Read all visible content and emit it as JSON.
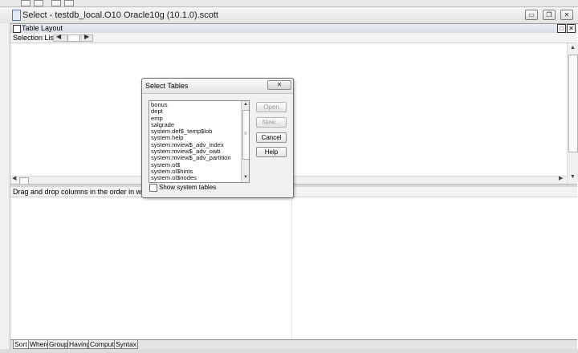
{
  "window": {
    "title": "Select - testdb_local.O10 Oracle10g (10.1.0).scott",
    "minimize_glyph": "▭",
    "restore_glyph": "❐",
    "close_glyph": "✕"
  },
  "table_layout": {
    "header": "Table Layout",
    "restore_glyph": "□",
    "close_glyph": "✕",
    "selection_list_label": "Selection List:"
  },
  "hint": {
    "text": "Drag and drop columns in the order in which you wa"
  },
  "tabs": [
    "Sort",
    "Where",
    "Group",
    "Having",
    "Compute",
    "Syntax"
  ],
  "dialog": {
    "title": "Select Tables",
    "close_glyph": "✕",
    "tables": [
      "bonus",
      "dept",
      "emp",
      "salgrade",
      "system.def$_temp$lob",
      "system.help",
      "system.mview$_adv_index",
      "system.mview$_adv_owb",
      "system.mview$_adv_partition",
      "system.ol$",
      "system.ol$hints",
      "system.ol$nodes"
    ],
    "buttons": {
      "open": "Open",
      "new": "New...",
      "cancel": "Cancel",
      "help": "Help"
    },
    "show_system_tables": "Show system tables"
  },
  "icons": {
    "arrow_left": "◀",
    "arrow_right": "▶",
    "arrow_up": "▲",
    "arrow_down": "▼",
    "grip": "≡"
  }
}
